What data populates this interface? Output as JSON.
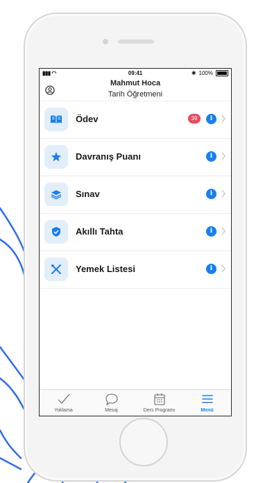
{
  "status_bar": {
    "time": "09:41",
    "battery": "100%"
  },
  "header": {
    "name": "Mahmut Hoca",
    "role": "Tarih Öğretmeni"
  },
  "menu_items": [
    {
      "label": "Ödev",
      "icon": "book-icon",
      "badge": "39"
    },
    {
      "label": "Davranış Puanı",
      "icon": "star-icon"
    },
    {
      "label": "Sınav",
      "icon": "layers-icon"
    },
    {
      "label": "Akıllı Tahta",
      "icon": "shield-check-icon"
    },
    {
      "label": "Yemek Listesi",
      "icon": "utensils-icon"
    }
  ],
  "tab_bar": {
    "tabs": [
      {
        "label": "Yoklama",
        "icon": "check-icon"
      },
      {
        "label": "Mesaj",
        "icon": "chat-bubble-icon"
      },
      {
        "label": "Ders Programı",
        "icon": "calendar-icon"
      },
      {
        "label": "Menü",
        "icon": "menu-icon",
        "active": true
      }
    ]
  },
  "colors": {
    "accent": "#1a7ff0",
    "tile_background": "#e3eefb",
    "badge": "#ec4b5e",
    "sketch": "#2f6df0"
  }
}
